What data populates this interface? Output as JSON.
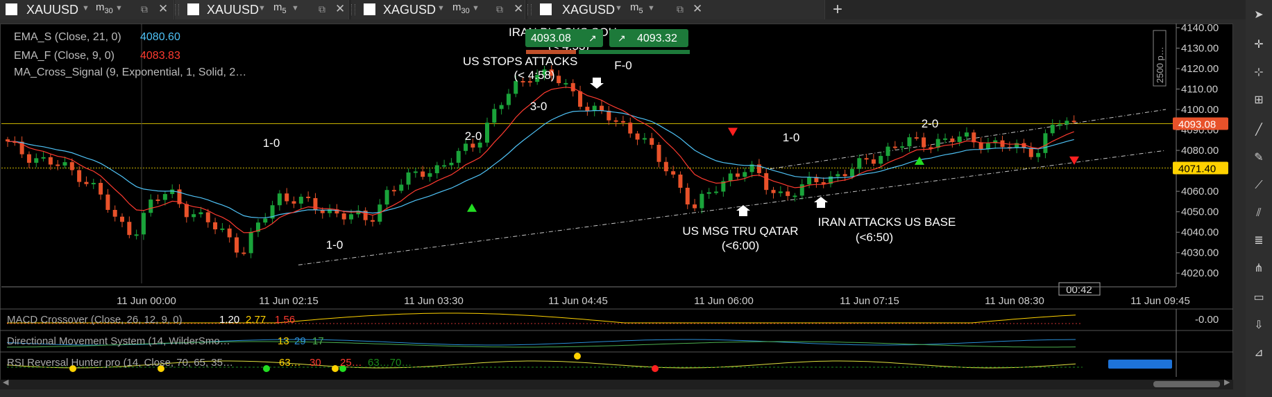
{
  "tabs": [
    {
      "symbol": "XAUUSD",
      "timeframe": "m",
      "tf_sub": "30",
      "active": false
    },
    {
      "symbol": "XAUUSD",
      "timeframe": "m",
      "tf_sub": "5",
      "active": true
    },
    {
      "symbol": "XAGUSD",
      "timeframe": "m",
      "tf_sub": "30",
      "active": false
    },
    {
      "symbol": "XAGUSD",
      "timeframe": "m",
      "tf_sub": "5",
      "active": false
    }
  ],
  "tab_icons": {
    "dropdown": "▼",
    "external": "⧉",
    "close": "✕",
    "new_tab": "+"
  },
  "toolbar_icons": [
    "pointer-icon",
    "crosshair-icon",
    "crosshair-plus-icon",
    "plus-square-icon",
    "line-icon",
    "brush-icon",
    "ray-icon",
    "parallel-channel-icon",
    "fibonacci-icon",
    "pitchfork-icon",
    "rectangle-icon",
    "arrow-down-icon",
    "measure-icon"
  ],
  "colors": {
    "ema_s": "#4fc3f7",
    "ema_f": "#ff3b30",
    "bull": "#1aa33a",
    "bear": "#e8522a",
    "price_badge": "#e8522a",
    "level_badge": "#ffd200",
    "hline": "#c9b400",
    "channel": "#c8c8c8"
  },
  "indicators": {
    "ema_s_label": "EMA_S (Close, 21, 0)",
    "ema_s_value": "4080.60",
    "ema_f_label": "EMA_F (Close, 9, 0)",
    "ema_f_value": "4083.83",
    "ma_cross_label": "MA_Cross_Signal (9, Exponential, 1, Solid, 2…"
  },
  "trade_panel": {
    "bid": "4093.08",
    "ask": "4093.32",
    "bid_icon": "↗",
    "ask_icon": "↗"
  },
  "annotations": {
    "iran_blocks": "IRAN BLOCKS SOH",
    "iran_blocks_sub": "(< 4:53)",
    "us_stops": "US STOPS ATTACKS",
    "us_stops_sub": "(< 4:58)",
    "us_msg": "US MSG TRU QATAR",
    "us_msg_sub": "(<6:00)",
    "iran_attacks": "IRAN ATTACKS US BASE",
    "iran_attacks_sub": "(<6:50)"
  },
  "score_labels": [
    "1-0",
    "1-0",
    "2-0",
    "3-0",
    "F-0",
    "1-0",
    "2-0"
  ],
  "price_axis": {
    "ticks": [
      "4140.00",
      "4130.00",
      "4120.00",
      "4110.00",
      "4100.00",
      "4090.00",
      "4080.00",
      "4070.00",
      "4060.00",
      "4050.00",
      "4040.00",
      "4030.00",
      "4020.00"
    ],
    "current": "4093.08",
    "level": "4071.40",
    "pip_ruler": "2500 p…",
    "countdown": "00:42"
  },
  "time_axis": [
    "11 Jun 00:00",
    "11 Jun 02:15",
    "11 Jun 03:30",
    "11 Jun 04:45",
    "11 Jun 06:00",
    "11 Jun 07:15",
    "11 Jun 08:30",
    "11 Jun 09:45"
  ],
  "subpanels": {
    "macd_label": "MACD Crossover (Close, 26, 12, 9, 0)",
    "macd_v1": "1.20",
    "macd_v2": "2.77",
    "macd_v3": "1.56",
    "macd_axis": "-0.00",
    "dms_label": "Directional Movement System (14, WilderSmo…",
    "dms_v1": "13",
    "dms_v2": "29",
    "dms_v3": "17",
    "rsi_label": "RSI Reversal Hunter pro (14, Close, 70, 65, 35…",
    "rsi_v1": "63…",
    "rsi_v2": "30",
    "rsi_v3": "25…",
    "rsi_v4": "63…70…"
  },
  "chart_data": {
    "type": "candlestick",
    "ylim": [
      4015,
      4142
    ],
    "times": [
      "11 Jun 00:00",
      "11 Jun 02:15",
      "11 Jun 03:30",
      "11 Jun 04:45",
      "11 Jun 06:00",
      "11 Jun 07:15",
      "11 Jun 08:30",
      "11 Jun 09:45"
    ],
    "key_closes": [
      4083,
      4078,
      4075,
      4072,
      4068,
      4060,
      4045,
      4040,
      4055,
      4060,
      4050,
      4045,
      4040,
      4030,
      4045,
      4058,
      4056,
      4052,
      4050,
      4048,
      4045,
      4060,
      4065,
      4070,
      4072,
      4078,
      4085,
      4100,
      4110,
      4118,
      4117,
      4110,
      4102,
      4097,
      4092,
      4088,
      4075,
      4065,
      4052,
      4060,
      4068,
      4072,
      4062,
      4058,
      4062,
      4066,
      4068,
      4072,
      4077,
      4082,
      4084,
      4084,
      4085,
      4086,
      4084,
      4082,
      4081,
      4080,
      4094,
      4093
    ],
    "ema_s_end": 4080.6,
    "ema_f_end": 4083.83,
    "current_price": 4093.08,
    "horizontal_level": 4071.4
  }
}
